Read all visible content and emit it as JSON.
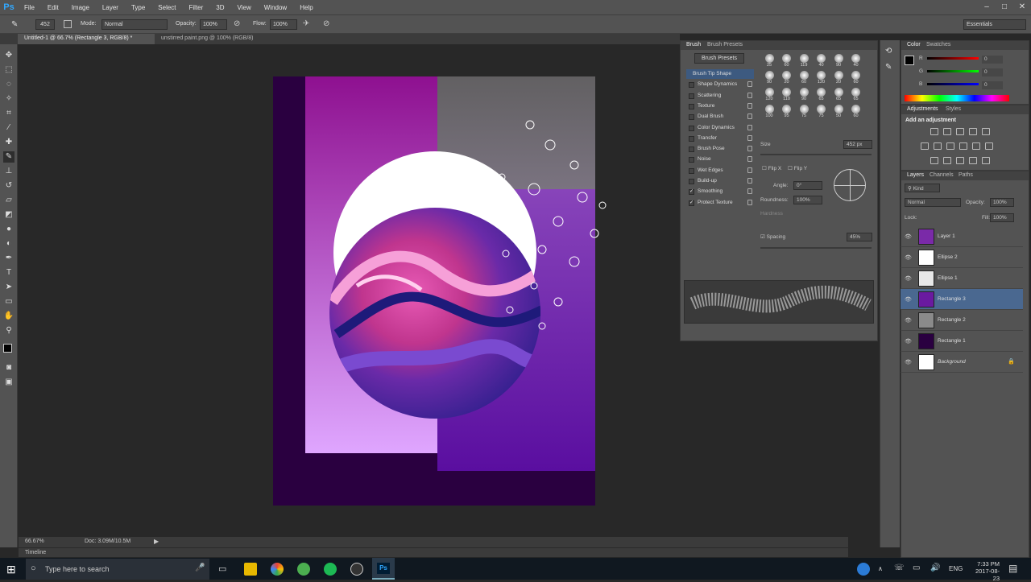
{
  "app": {
    "logo": "Ps"
  },
  "menu": [
    "File",
    "Edit",
    "Image",
    "Layer",
    "Type",
    "Select",
    "Filter",
    "3D",
    "View",
    "Window",
    "Help"
  ],
  "options": {
    "size": "452",
    "mode_label": "Mode:",
    "mode_value": "Normal",
    "opacity_label": "Opacity:",
    "opacity_value": "100%",
    "flow_label": "Flow:",
    "flow_value": "100%",
    "workspace": "Essentials"
  },
  "tabs": [
    {
      "label": "Untitled-1 @ 66.7% (Rectangle 3, RGB/8) *"
    },
    {
      "label": "unstirred paint.png @ 100% (RGB/8)"
    }
  ],
  "status": {
    "zoom": "66.67%",
    "doc": "Doc: 3.09M/10.5M"
  },
  "timeline": {
    "label": "Timeline"
  },
  "brush_panel": {
    "tabs": [
      "Brush",
      "Brush Presets"
    ],
    "presets_button": "Brush Presets",
    "options": [
      {
        "label": "Brush Tip Shape",
        "checked": null
      },
      {
        "label": "Shape Dynamics",
        "checked": false
      },
      {
        "label": "Scattering",
        "checked": false
      },
      {
        "label": "Texture",
        "checked": false
      },
      {
        "label": "Dual Brush",
        "checked": false
      },
      {
        "label": "Color Dynamics",
        "checked": false
      },
      {
        "label": "Transfer",
        "checked": false
      },
      {
        "label": "Brush Pose",
        "checked": false
      },
      {
        "label": "Noise",
        "checked": false
      },
      {
        "label": "Wet Edges",
        "checked": false
      },
      {
        "label": "Build-up",
        "checked": false
      },
      {
        "label": "Smoothing",
        "checked": true
      },
      {
        "label": "Protect Texture",
        "checked": true
      }
    ],
    "sizes": [
      "25",
      "60",
      "119",
      "40",
      "90",
      "40",
      "90",
      "20",
      "60",
      "120",
      "20",
      "60",
      "120",
      "110",
      "90",
      "65",
      "65",
      "65",
      "100",
      "95",
      "75",
      "75",
      "50",
      "60"
    ],
    "size_label": "Size",
    "size_value": "452 px",
    "flipx": "Flip X",
    "flipy": "Flip Y",
    "angle_label": "Angle:",
    "angle_value": "0°",
    "roundness_label": "Roundness:",
    "roundness_value": "100%",
    "hardness_label": "Hardness",
    "spacing_label": "Spacing",
    "spacing_value": "45%"
  },
  "color_panel": {
    "tabs": [
      "Color",
      "Swatches"
    ],
    "r_label": "R",
    "g_label": "G",
    "b_label": "B",
    "r": "0",
    "g": "0",
    "b": "0"
  },
  "adjustments": {
    "tabs": [
      "Adjustments",
      "Styles"
    ],
    "title": "Add an adjustment"
  },
  "layers_panel": {
    "tabs": [
      "Layers",
      "Channels",
      "Paths"
    ],
    "kind": "Kind",
    "blend": "Normal",
    "opacity_label": "Opacity:",
    "opacity_value": "100%",
    "lock_label": "Lock:",
    "fill_label": "Fill:",
    "fill_value": "100%",
    "layers": [
      {
        "name": "Layer 1",
        "thumb": "#7a2aa8",
        "selected": false
      },
      {
        "name": "Ellipse 2",
        "thumb": "#ffffff",
        "selected": false
      },
      {
        "name": "Ellipse 1",
        "thumb": "#e8e8e8",
        "selected": false
      },
      {
        "name": "Rectangle 3",
        "thumb": "#6a1aa0",
        "selected": true
      },
      {
        "name": "Rectangle 2",
        "thumb": "#8a8a8a",
        "selected": false
      },
      {
        "name": "Rectangle 1",
        "thumb": "#2a0040",
        "selected": false
      },
      {
        "name": "Background",
        "thumb": "#ffffff",
        "selected": false
      }
    ]
  },
  "taskbar": {
    "search_placeholder": "Type here to search",
    "lang": "ENG",
    "time": "7:33 PM",
    "date": "2017-08-23"
  },
  "colors": {
    "accent": "#31a8ff",
    "panel": "#535353",
    "canvas_bg": "#282828"
  }
}
